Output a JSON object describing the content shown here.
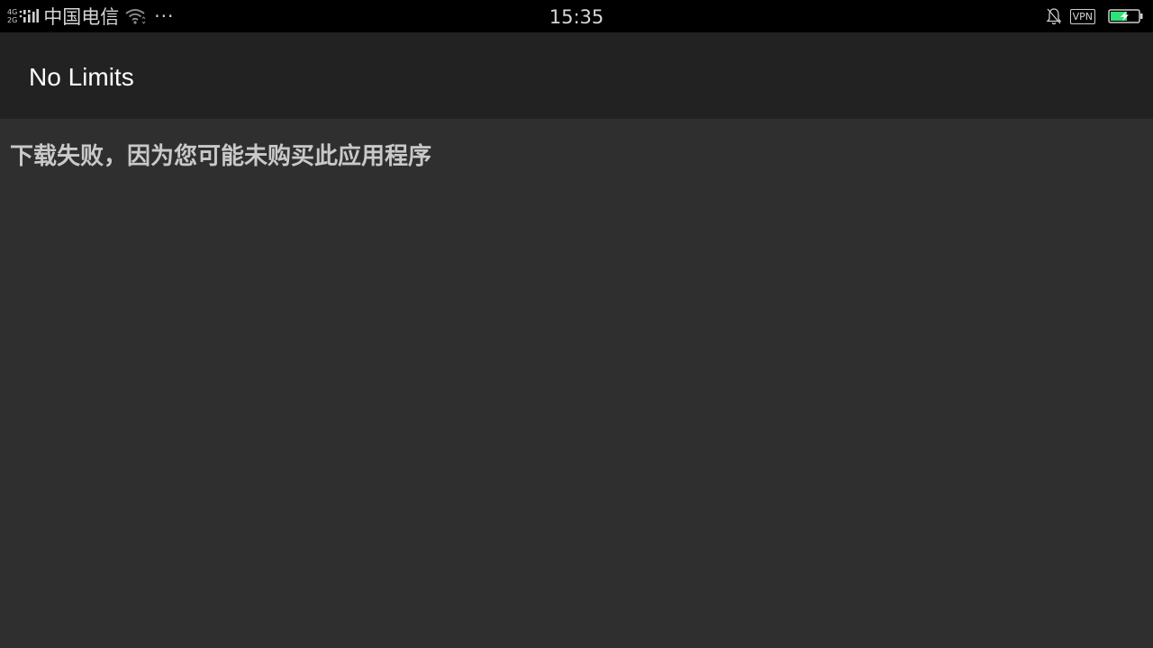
{
  "status_bar": {
    "network_top": "4G",
    "network_bottom": "2G",
    "carrier": "中国电信",
    "more": "···",
    "time": "15:35",
    "vpn": "VPN",
    "battery_color": "#2ee27a"
  },
  "app": {
    "title": "No Limits"
  },
  "content": {
    "message": "下载失败，因为您可能未购买此应用程序"
  }
}
